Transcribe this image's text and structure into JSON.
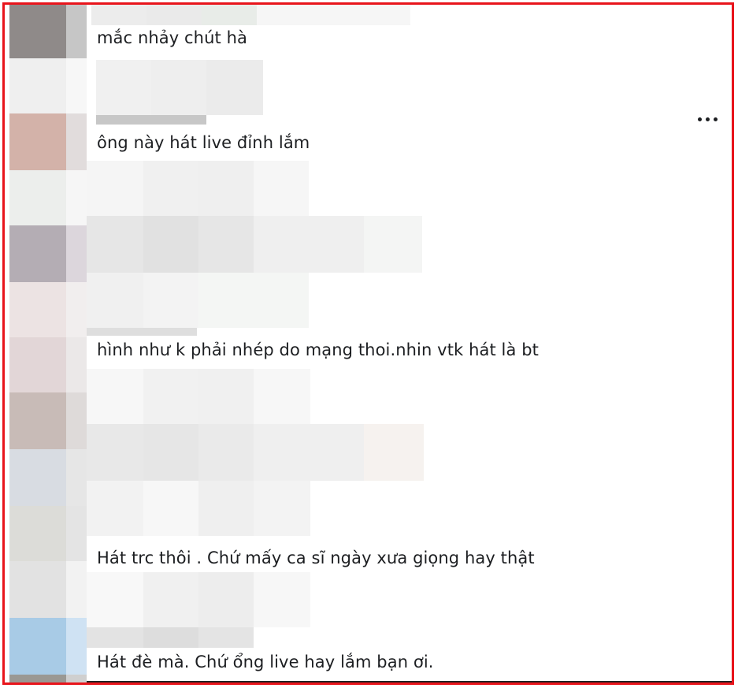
{
  "comments": [
    {
      "text": "mắc nhảy chút hà"
    },
    {
      "text": "ông này hát live đỉnh lắm"
    },
    {
      "text": "hình như k phải nhép do mạng thoi.nhin vtk hát là bt"
    },
    {
      "text": "Hát trc thôi . Chứ mấy ca sĩ ngày xưa giọng hay thật"
    },
    {
      "text": "Hát đè mà. Chứ ổng live hay lắm bạn ơi."
    }
  ],
  "more_icon": "more-horizontal-icon",
  "colors": {
    "frame_border": "#e8141b",
    "text": "#1c1e21"
  }
}
